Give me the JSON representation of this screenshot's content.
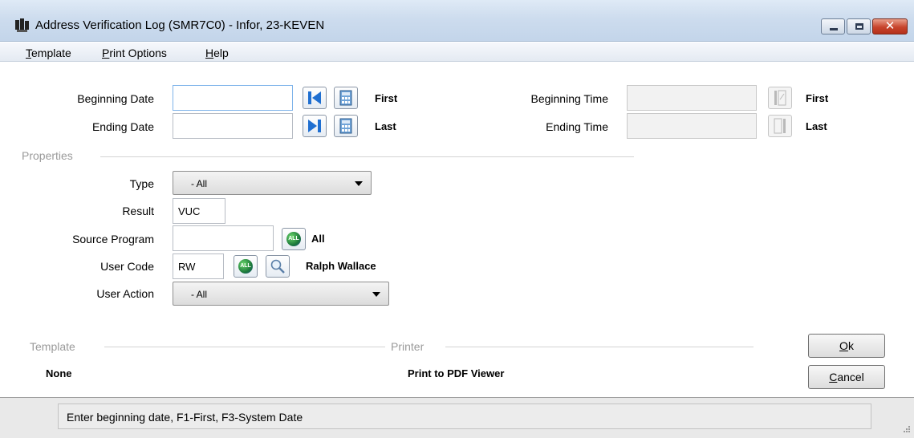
{
  "window": {
    "title": "Address Verification Log (SMR7C0) - Infor, 23-KEVEN",
    "controls": {
      "minimize": "minimize",
      "maximize": "maximize",
      "close": "✕"
    }
  },
  "menu": {
    "template": {
      "key": "T",
      "rest": "emplate"
    },
    "print_options": {
      "key": "P",
      "rest": "rint Options"
    },
    "help": {
      "key": "H",
      "rest": "elp"
    }
  },
  "dates": {
    "beginning_date_label": "Beginning Date",
    "beginning_date_value": "",
    "beginning_date_hint": "First",
    "ending_date_label": "Ending Date",
    "ending_date_value": "",
    "ending_date_hint": "Last"
  },
  "times": {
    "beginning_time_label": "Beginning Time",
    "beginning_time_value": "",
    "beginning_time_hint": "First",
    "ending_time_label": "Ending Time",
    "ending_time_value": "",
    "ending_time_hint": "Last"
  },
  "properties": {
    "section_label": "Properties",
    "type_label": "Type",
    "type_value": "- All",
    "result_label": "Result",
    "result_value": "VUC",
    "source_program_label": "Source Program",
    "source_program_value": "",
    "source_program_hint": "All",
    "user_code_label": "User Code",
    "user_code_value": "RW",
    "user_code_name": "Ralph Wallace",
    "user_action_label": "User Action",
    "user_action_value": "- All"
  },
  "footer": {
    "template_label": "Template",
    "template_value": "None",
    "printer_label": "Printer",
    "printer_value": "Print to PDF Viewer",
    "ok": {
      "key": "O",
      "rest": "k"
    },
    "cancel": {
      "key": "C",
      "rest": "ancel"
    }
  },
  "status": {
    "message": "Enter beginning date, F1-First, F3-System Date"
  },
  "colors": {
    "accent_blue": "#1f6fd1",
    "disabled_gray": "#9a9a9a"
  }
}
